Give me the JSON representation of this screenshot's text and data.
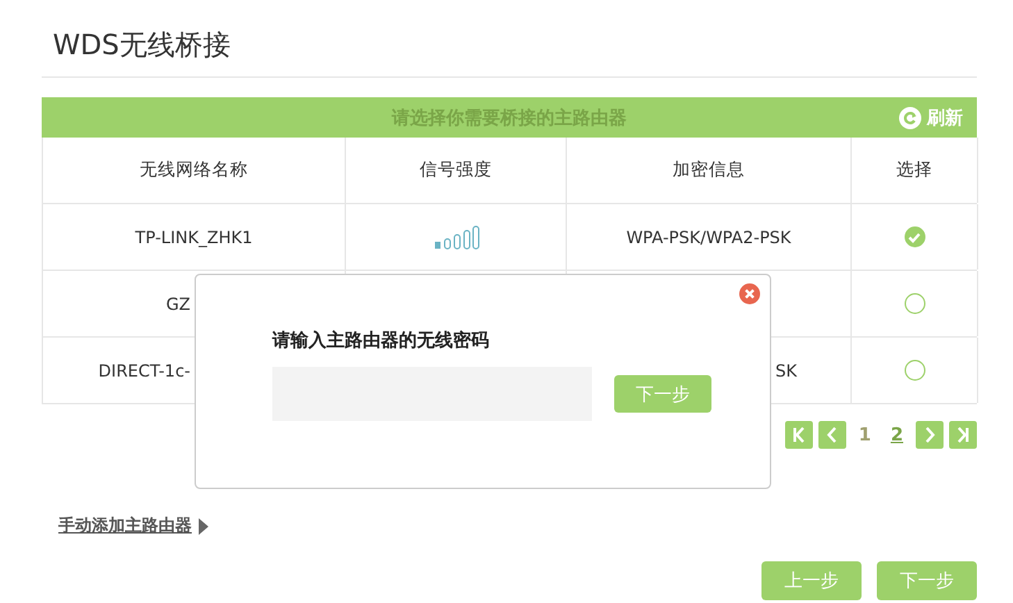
{
  "title": "WDS无线桥接",
  "table": {
    "caption": "请选择你需要桥接的主路由器",
    "refresh": "刷新",
    "columns": [
      "无线网络名称",
      "信号强度",
      "加密信息",
      "选择"
    ],
    "rows": [
      {
        "name": "TP-LINK_ZHK1",
        "signal": true,
        "encryption": "WPA-PSK/WPA2-PSK",
        "selected": true
      },
      {
        "name": "GZ",
        "selected": false
      },
      {
        "name": "DIRECT-1c-",
        "encryption": "SK",
        "selected": false
      }
    ]
  },
  "pagination": {
    "pages": [
      {
        "label": "1",
        "selected": true
      },
      {
        "label": "2",
        "selected": false
      }
    ]
  },
  "manual_link": "手动添加主路由器",
  "buttons": [
    "上一步",
    "下一步"
  ],
  "dialog": {
    "label": "请输入主路由器的无线密码",
    "button": "下一步"
  }
}
